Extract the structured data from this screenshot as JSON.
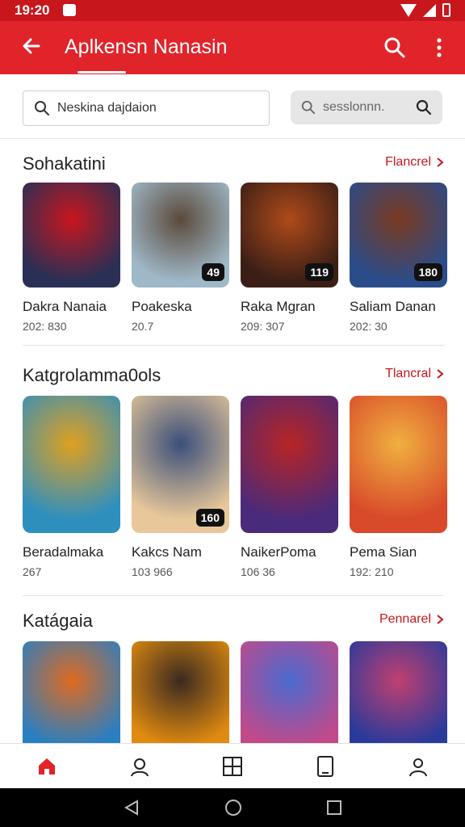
{
  "status": {
    "time": "19:20"
  },
  "appbar": {
    "title": "Aplkensn Nanasin"
  },
  "search": {
    "value": "Neskina dajdaion",
    "filter_placeholder": "sesslonnn."
  },
  "sections": [
    {
      "title": "Sohakatini",
      "see_all": "Flancrel",
      "cards": [
        {
          "name": "Dakra Nanaia",
          "meta": "202: 830",
          "badge": "",
          "colors": [
            "#2a2f55",
            "#c8161d"
          ]
        },
        {
          "name": "Poakeska",
          "meta": "20.7",
          "badge": "49",
          "colors": [
            "#9fb8c8",
            "#5b4a3a"
          ]
        },
        {
          "name": "Raka Mgran",
          "meta": "209: 307",
          "badge": "119",
          "colors": [
            "#3b1f16",
            "#b04a1a"
          ]
        },
        {
          "name": "Saliam Danan",
          "meta": "202: 30",
          "badge": "180",
          "colors": [
            "#2b4c8a",
            "#7a3a1f"
          ]
        }
      ]
    },
    {
      "title": "Katgrolamma0ols",
      "see_all": "Tlancral",
      "cards": [
        {
          "name": "Beradalmaka",
          "meta": "267",
          "badge": "",
          "colors": [
            "#2e8fbf",
            "#e0a020"
          ]
        },
        {
          "name": "Kakcs Nam",
          "meta": "103 966",
          "badge": "160",
          "colors": [
            "#e8c89a",
            "#3a4f7a"
          ]
        },
        {
          "name": "NaikerPoma",
          "meta": "106 36",
          "badge": "",
          "colors": [
            "#4a2a7a",
            "#b82424"
          ]
        },
        {
          "name": "Pema Sian",
          "meta": "192: 210",
          "badge": "",
          "colors": [
            "#d84a2a",
            "#f0b040"
          ]
        }
      ]
    },
    {
      "title": "Katágaia",
      "see_all": "Pennarel",
      "cards": [
        {
          "name": "",
          "meta": "",
          "badge": "",
          "colors": [
            "#2a7fc0",
            "#e06a20"
          ]
        },
        {
          "name": "",
          "meta": "",
          "badge": "",
          "colors": [
            "#e08a10",
            "#3a2a20"
          ]
        },
        {
          "name": "",
          "meta": "",
          "badge": "",
          "colors": [
            "#c04a8a",
            "#4a6ad0"
          ]
        },
        {
          "name": "",
          "meta": "",
          "badge": "",
          "colors": [
            "#2a3a9a",
            "#c04070"
          ]
        }
      ]
    }
  ],
  "nav": [
    "home-icon",
    "support-icon",
    "grid-icon",
    "tablet-icon",
    "profile-icon"
  ],
  "colors": {
    "primary": "#e0242a",
    "accent": "#c8161d"
  }
}
